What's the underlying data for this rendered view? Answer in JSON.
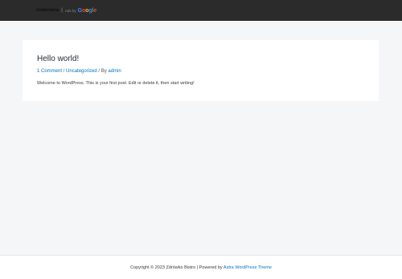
{
  "header": {
    "brand_name": "DOBRYAKA",
    "separator": "|",
    "ads_by": "Ads by",
    "google": [
      "G",
      "o",
      "o",
      "g",
      "l",
      "e"
    ],
    "google_colors": [
      "#4285F4",
      "#EA4335",
      "#FBBC05",
      "#4285F4",
      "#34A853",
      "#EA4335"
    ]
  },
  "post": {
    "title": "Hello world!",
    "meta": {
      "comments_link": "1 Comment",
      "sep1": " / ",
      "category_link": "Uncategorized",
      "sep2": " / By ",
      "author_link": "admin"
    },
    "content": "Welcome to WordPress. This is your first post. Edit or delete it, then start writing!"
  },
  "footer": {
    "copyright": "Copyright © 2023 Zdrówko Bistro | Powered by ",
    "theme_link": "Astra WordPress Theme"
  },
  "colors": {
    "header_bg": "#2b2b2b",
    "link": "#0274be",
    "page_bg": "#f5f6f7"
  }
}
